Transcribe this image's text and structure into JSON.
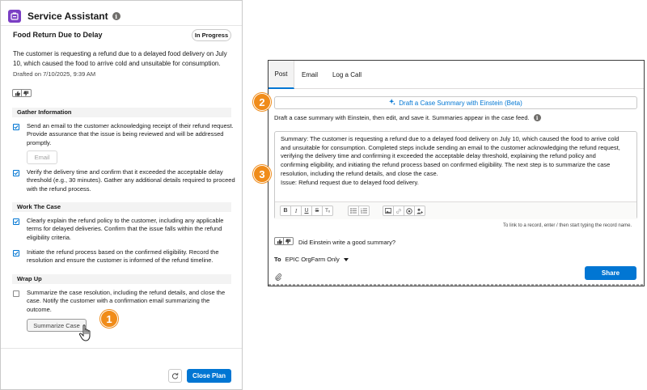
{
  "assistant": {
    "title": "Service Assistant",
    "plan_title": "Food Return Due to Delay",
    "status": "In Progress",
    "description": "The customer is requesting a refund due to a delayed food delivery on July 10, which caused the food to arrive cold and unsuitable for consumption.",
    "drafted": "Drafted on 7/10/2025, 9:39 AM",
    "sections": [
      {
        "heading": "Gather Information",
        "tasks": [
          {
            "text": "Send an email to the customer acknowledging receipt of their refund request. Provide assurance that the issue is being reviewed and will be addressed promptly.",
            "checked": true,
            "button": "Email"
          },
          {
            "text": "Verify the delivery time and confirm that it exceeded the acceptable delay threshold (e.g., 30 minutes). Gather any additional details required to proceed with the refund process.",
            "checked": true
          }
        ]
      },
      {
        "heading": "Work The Case",
        "tasks": [
          {
            "text": "Clearly explain the refund policy to the customer, including any applicable terms for delayed deliveries. Confirm that the issue falls within the refund eligibility criteria.",
            "checked": true
          },
          {
            "text": "Initiate the refund process based on the confirmed eligibility. Record the resolution and ensure the customer is informed of the refund timeline.",
            "checked": true
          }
        ]
      },
      {
        "heading": "Wrap Up",
        "tasks": [
          {
            "text": "Summarize the case resolution, including the refund details, and close the case. Notify the customer with a confirmation email summarizing the outcome.",
            "checked": false,
            "button": "Summarize Case"
          }
        ]
      }
    ],
    "close_label": "Close Plan"
  },
  "callouts": [
    "1",
    "2",
    "3"
  ],
  "feed": {
    "tabs": [
      "Post",
      "Email",
      "Log a Call"
    ],
    "active_tab": "Post",
    "draft_button": "Draft a Case Summary with Einstein (Beta)",
    "helper": "Draft a case summary with Einstein, then edit, and save it. Summaries appear in the case feed.",
    "summary_lines": [
      "Summary: The customer is requesting a refund due to a delayed food delivery on July 10, which caused the food to arrive cold",
      "and unsuitable for consumption. Completed steps include sending an email to the customer acknowledging the refund request,",
      "verifying the delivery time and confirming it exceeded the acceptable delay threshold, explaining the refund policy and",
      "confirming eligibility, and initiating the refund process based on confirmed eligibility. The next step is to summarize the case",
      "resolution, including the refund details, and close the case.",
      "Issue: Refund request due to delayed food delivery."
    ],
    "record_hint": "To link to a record, enter / then start typing the record name.",
    "feedback_question": "Did Einstein write a good summary?",
    "to_label": "To",
    "audience": "EPIC OrgFarm Only",
    "share_label": "Share"
  },
  "toolbar_icons": [
    "bold-icon",
    "italic-icon",
    "underline-icon",
    "strikethrough-icon",
    "clear-format-icon",
    "bullet-list-icon",
    "numbered-list-icon",
    "image-icon",
    "link-icon",
    "mention-icon",
    "user-icon"
  ],
  "colors": {
    "brand": "#0176d3",
    "callout": "#f08c1a",
    "assistant_logo": "#7b3fc4"
  }
}
